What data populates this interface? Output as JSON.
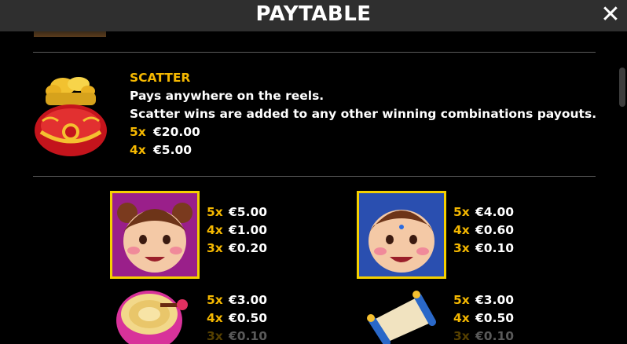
{
  "header": {
    "title": "PAYTABLE",
    "close_label": "✕"
  },
  "scatter": {
    "title": "SCATTER",
    "line1": "Pays anywhere on the reels.",
    "line2": "Scatter wins are added to any other winning combinations payouts.",
    "pays": [
      {
        "count": "5x",
        "value": "€20.00"
      },
      {
        "count": "4x",
        "value": "€5.00"
      }
    ]
  },
  "symbols": [
    {
      "icon": "girl-symbol-icon",
      "pays": [
        {
          "count": "5x",
          "value": "€5.00"
        },
        {
          "count": "4x",
          "value": "€1.00"
        },
        {
          "count": "3x",
          "value": "€0.20"
        }
      ]
    },
    {
      "icon": "boy-symbol-icon",
      "pays": [
        {
          "count": "5x",
          "value": "€4.00"
        },
        {
          "count": "4x",
          "value": "€0.60"
        },
        {
          "count": "3x",
          "value": "€0.10"
        }
      ]
    },
    {
      "icon": "drum-symbol-icon",
      "pays": [
        {
          "count": "5x",
          "value": "€3.00"
        },
        {
          "count": "4x",
          "value": "€0.50"
        },
        {
          "count": "3x",
          "value": "€0.10"
        }
      ]
    },
    {
      "icon": "scroll-symbol-icon",
      "pays": [
        {
          "count": "5x",
          "value": "€3.00"
        },
        {
          "count": "4x",
          "value": "€0.50"
        },
        {
          "count": "3x",
          "value": "€0.10"
        }
      ]
    }
  ],
  "colors": {
    "accent": "#f5b800",
    "header_bg": "#2f2f2f",
    "frame": "#f5d000"
  }
}
